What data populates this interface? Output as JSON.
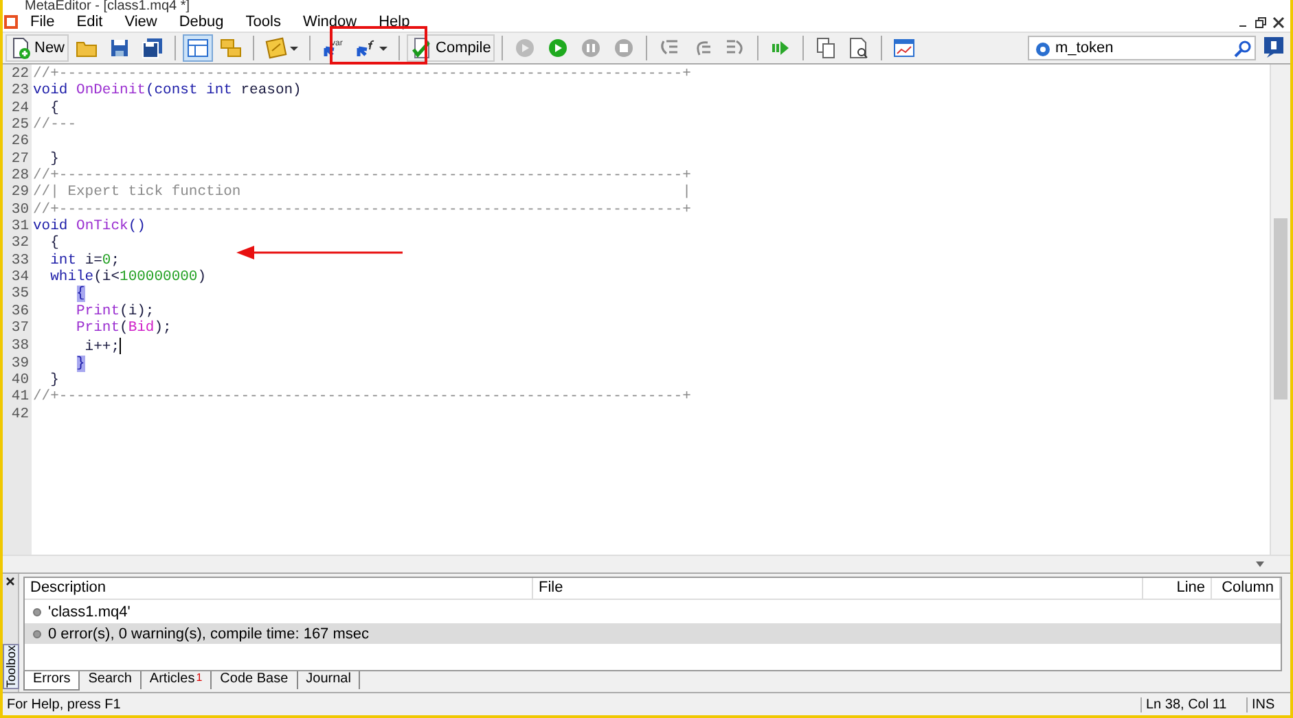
{
  "window": {
    "title": "MetaEditor - [class1.mq4 *]"
  },
  "menu": [
    "File",
    "Edit",
    "View",
    "Debug",
    "Tools",
    "Window",
    "Help"
  ],
  "toolbar": [
    {
      "kind": "new",
      "label": "New"
    },
    {
      "kind": "open"
    },
    {
      "kind": "save"
    },
    {
      "kind": "saveall"
    },
    {
      "kind": "sep"
    },
    {
      "kind": "navigator",
      "selected": true
    },
    {
      "kind": "toolbox",
      "selected": false
    },
    {
      "kind": "sep"
    },
    {
      "kind": "styler"
    },
    {
      "kind": "sep"
    },
    {
      "kind": "var"
    },
    {
      "kind": "func"
    },
    {
      "kind": "sep"
    },
    {
      "kind": "compile",
      "label": "Compile"
    },
    {
      "kind": "sep"
    },
    {
      "kind": "debug"
    },
    {
      "kind": "play"
    },
    {
      "kind": "pause"
    },
    {
      "kind": "stop"
    },
    {
      "kind": "sep"
    },
    {
      "kind": "stepin"
    },
    {
      "kind": "stepover"
    },
    {
      "kind": "stepout"
    },
    {
      "kind": "sep"
    },
    {
      "kind": "go"
    },
    {
      "kind": "sep"
    },
    {
      "kind": "copy"
    },
    {
      "kind": "find"
    },
    {
      "kind": "sep"
    },
    {
      "kind": "chart"
    }
  ],
  "search": {
    "value": "m_token"
  },
  "editor": {
    "lines": [
      {
        "number": "22",
        "tokens": [
          {
            "kind": "comment",
            "text": "//+------------------------------------------------------------------------+"
          }
        ]
      },
      {
        "number": "23",
        "tokens": [
          {
            "kind": "keyword",
            "text": "void "
          },
          {
            "kind": "function",
            "text": "OnDeinit"
          },
          {
            "kind": "keyword",
            "text": "(const int "
          },
          {
            "kind": "plain",
            "text": "reason)"
          }
        ]
      },
      {
        "number": "24",
        "tokens": [
          {
            "kind": "plain",
            "text": "  {"
          }
        ]
      },
      {
        "number": "25",
        "tokens": [
          {
            "kind": "comment",
            "text": "//---"
          }
        ]
      },
      {
        "number": "26"
      },
      {
        "number": "27",
        "tokens": [
          {
            "kind": "plain",
            "text": "  }"
          }
        ]
      },
      {
        "number": "28",
        "tokens": [
          {
            "kind": "comment",
            "text": "//+------------------------------------------------------------------------+"
          }
        ]
      },
      {
        "number": "29",
        "tokens": [
          {
            "kind": "comment",
            "text": "//| Expert tick function                                                   |"
          }
        ]
      },
      {
        "number": "30",
        "tokens": [
          {
            "kind": "comment",
            "text": "//+------------------------------------------------------------------------+"
          }
        ]
      },
      {
        "number": "31",
        "tokens": [
          {
            "kind": "keyword",
            "text": "void "
          },
          {
            "kind": "function",
            "text": "OnTick"
          },
          {
            "kind": "keyword",
            "text": "()"
          }
        ]
      },
      {
        "number": "32",
        "tokens": [
          {
            "kind": "plain",
            "text": "  {"
          }
        ]
      },
      {
        "number": "33",
        "tokens": [
          {
            "kind": "keyword",
            "text": "  int "
          },
          {
            "kind": "plain",
            "text": "i="
          },
          {
            "kind": "number",
            "text": "0"
          },
          {
            "kind": "plain",
            "text": ";"
          }
        ]
      },
      {
        "number": "34",
        "tokens": [
          {
            "kind": "keyword",
            "text": "  while"
          },
          {
            "kind": "plain",
            "text": "(i<"
          },
          {
            "kind": "number",
            "text": "100000000"
          },
          {
            "kind": "plain",
            "text": ")"
          }
        ]
      },
      {
        "number": "35",
        "tokens": [
          {
            "kind": "brace",
            "text": "{",
            "indent": true
          }
        ]
      },
      {
        "number": "36",
        "tokens": [
          {
            "kind": "function",
            "text": "     Print"
          },
          {
            "kind": "plain",
            "text": "(i);"
          }
        ]
      },
      {
        "number": "37",
        "tokens": [
          {
            "kind": "function",
            "text": "     Print"
          },
          {
            "kind": "plain",
            "text": "("
          },
          {
            "kind": "constant",
            "text": "Bid"
          },
          {
            "kind": "plain",
            "text": ");"
          }
        ]
      },
      {
        "number": "38",
        "tokens": [
          {
            "kind": "plain",
            "text": "      i++;"
          },
          {
            "kind": "caret"
          }
        ]
      },
      {
        "number": "39",
        "tokens": [
          {
            "kind": "brace",
            "text": "}",
            "indent": true
          }
        ]
      },
      {
        "number": "40",
        "tokens": [
          {
            "kind": "plain",
            "text": "  }"
          }
        ]
      },
      {
        "number": "41",
        "tokens": [
          {
            "kind": "comment",
            "text": "//+------------------------------------------------------------------------+"
          }
        ]
      },
      {
        "number": "42"
      }
    ]
  },
  "toolbox": {
    "label": "Toolbox",
    "columns": [
      "Description",
      "File",
      "Line",
      "Column"
    ],
    "rows": [
      {
        "description": "'class1.mq4'",
        "selected": false
      },
      {
        "description": "0 error(s), 0 warning(s), compile time: 167 msec",
        "selected": true
      }
    ],
    "tabs": [
      {
        "label": "Errors",
        "selected": true
      },
      {
        "label": "Search",
        "selected": false
      },
      {
        "label": "Articles",
        "badge": "1",
        "selected": false
      },
      {
        "label": "Code Base",
        "selected": false
      },
      {
        "label": "Journal",
        "selected": false
      }
    ]
  },
  "status_bar": {
    "help": "For Help, press F1",
    "position": "Ln 38, Col 11",
    "mode": "INS"
  }
}
